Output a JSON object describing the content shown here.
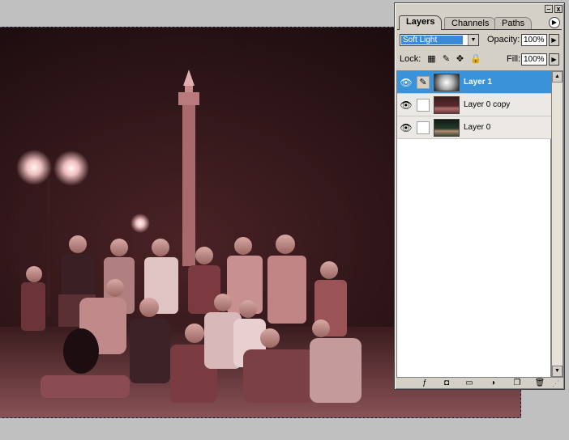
{
  "palette": {
    "tabs": [
      "Layers",
      "Channels",
      "Paths"
    ],
    "menu_icon": "triangle-right-icon",
    "minimize_label": "–",
    "close_label": "x",
    "blend_mode": "Soft Light",
    "opacity_label": "Opacity:",
    "opacity_value": "100%",
    "lock_label": "Lock:",
    "fill_label": "Fill:",
    "fill_value": "100%",
    "lock_icons": [
      "lock-transparent-icon",
      "lock-brush-icon",
      "lock-move-icon",
      "lock-all-icon"
    ],
    "layers": [
      {
        "name": "Layer 1",
        "selected": true,
        "thumb": "gradient"
      },
      {
        "name": "Layer 0 copy",
        "selected": false,
        "thumb": "photo-red"
      },
      {
        "name": "Layer 0",
        "selected": false,
        "thumb": "photo"
      }
    ],
    "bottom_icons": [
      "layer-style-icon",
      "add-mask-icon",
      "new-group-icon",
      "adjustment-layer-icon",
      "new-layer-icon",
      "trash-icon"
    ]
  },
  "colors": {
    "selection_blue": "#3a93d8",
    "photo_tint": "#c88a8a",
    "panel_gray": "#d4d0c8"
  }
}
